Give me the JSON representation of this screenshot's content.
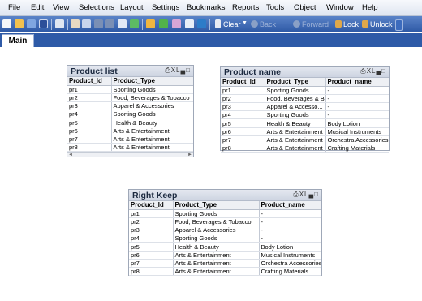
{
  "menu": [
    "File",
    "Edit",
    "View",
    "Selections",
    "Layout",
    "Settings",
    "Bookmarks",
    "Reports",
    "Tools",
    "Object",
    "Window",
    "Help"
  ],
  "toolbar": {
    "clear": "Clear",
    "back": "Back",
    "forward": "Forward",
    "lock": "Lock",
    "unlock": "Unlock"
  },
  "tabs": [
    "Main"
  ],
  "product_list": {
    "title": "Product list",
    "controls": "XL",
    "columns": [
      "Product_Id",
      "Product_Type"
    ],
    "rows": [
      [
        "pr1",
        "Sporting Goods"
      ],
      [
        "pr2",
        "Food, Beverages & Tobacco"
      ],
      [
        "pr3",
        "Apparel & Accessories"
      ],
      [
        "pr4",
        "Sporting Goods"
      ],
      [
        "pr5",
        "Health & Beauty"
      ],
      [
        "pr6",
        "Arts & Entertainment"
      ],
      [
        "pr7",
        "Arts & Entertainment"
      ],
      [
        "pr8",
        "Arts & Entertainment"
      ]
    ]
  },
  "product_name": {
    "title": "Product name",
    "controls": "XL",
    "columns": [
      "Product_Id",
      "Product_Type",
      "Product_name"
    ],
    "rows": [
      [
        "pr1",
        "Sporting Goods",
        "-"
      ],
      [
        "pr2",
        "Food, Beverages & B...",
        "-"
      ],
      [
        "pr3",
        "Apparel & Accesso...",
        "-"
      ],
      [
        "pr4",
        "Sporting Goods",
        "-"
      ],
      [
        "pr5",
        "Health & Beauty",
        "Body Lotion"
      ],
      [
        "pr6",
        "Arts & Entertainment",
        "Musical Instruments"
      ],
      [
        "pr7",
        "Arts & Entertainment",
        "Orchestra Accessories"
      ],
      [
        "pr8",
        "Arts & Entertainment",
        "Crafting Materials"
      ]
    ]
  },
  "right_keep": {
    "title": "Right Keep",
    "controls": "XL",
    "columns": [
      "Product_Id",
      "Product_Type",
      "Product_name"
    ],
    "rows": [
      [
        "pr1",
        "Sporting Goods",
        "-"
      ],
      [
        "pr2",
        "Food, Beverages & Tobacco",
        "-"
      ],
      [
        "pr3",
        "Apparel & Accessories",
        "-"
      ],
      [
        "pr4",
        "Sporting Goods",
        "-"
      ],
      [
        "pr5",
        "Health & Beauty",
        "Body Lotion"
      ],
      [
        "pr6",
        "Arts & Entertainment",
        "Musical Instruments"
      ],
      [
        "pr7",
        "Arts & Entertainment",
        "Orchestra Accessories"
      ],
      [
        "pr8",
        "Arts & Entertainment",
        "Crafting Materials"
      ]
    ]
  }
}
